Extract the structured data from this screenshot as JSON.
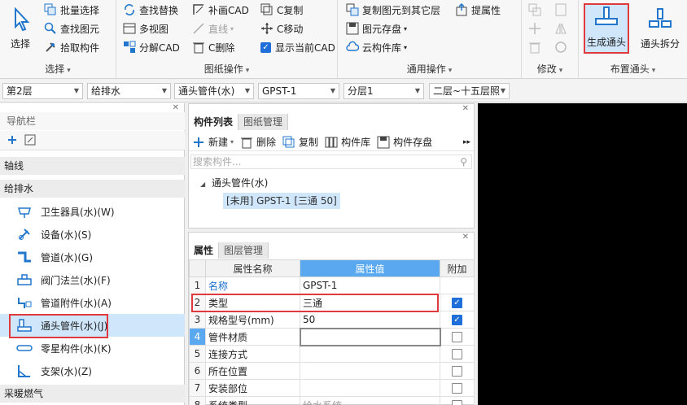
{
  "ribbon": {
    "select_label": "选择",
    "group_select": {
      "label": "选择",
      "items": [
        "批量选择",
        "查找图元",
        "拾取构件"
      ]
    },
    "group_drawing": {
      "label": "图纸操作",
      "col1": [
        "查找替换",
        "多视图",
        "分解CAD"
      ],
      "col2": [
        "补画CAD",
        "直线",
        "C删除"
      ],
      "col3": [
        "C复制",
        "C移动",
        "显示当前CAD"
      ]
    },
    "group_common": {
      "label": "通用操作",
      "col1": [
        "复制图元到其它层",
        "图元存盘",
        "云构件库"
      ],
      "col2": [
        "提属性"
      ]
    },
    "group_modify": {
      "label": "修改"
    },
    "group_tee": {
      "label": "布置通头",
      "generate": "生成通头",
      "split": "通头拆分"
    }
  },
  "combos": [
    {
      "value": "第2层"
    },
    {
      "value": "给排水"
    },
    {
      "value": "通头管件(水)"
    },
    {
      "value": "GPST-1"
    },
    {
      "value": "分层1"
    },
    {
      "value": "二层~十五层照"
    }
  ],
  "nav": {
    "title": "导航栏",
    "section_axis": "轴线",
    "section_plumbing": "给排水",
    "items": [
      {
        "label": "卫生器具(水)(W)"
      },
      {
        "label": "设备(水)(S)"
      },
      {
        "label": "管道(水)(G)"
      },
      {
        "label": "阀门法兰(水)(F)"
      },
      {
        "label": "管道附件(水)(A)"
      },
      {
        "label": "通头管件(水)(J)"
      },
      {
        "label": "零星构件(水)(K)"
      },
      {
        "label": "支架(水)(Z)"
      }
    ],
    "section_heating": "采暖燃气"
  },
  "component_list": {
    "tab_active": "构件列表",
    "tab_other": "图纸管理",
    "tools": [
      "新建",
      "删除",
      "复制",
      "构件库",
      "构件存盘"
    ],
    "search_placeholder": "搜索构件...",
    "tree_root": "通头管件(水)",
    "tree_leaf": "[未用] GPST-1 [三通 50]"
  },
  "properties": {
    "tab_active": "属性",
    "tab_other": "图层管理",
    "headers": {
      "name": "属性名称",
      "value": "属性值",
      "extra": "附加"
    },
    "rows": [
      {
        "num": "1",
        "name": "名称",
        "value": "GPST-1",
        "checked": null
      },
      {
        "num": "2",
        "name": "类型",
        "value": "三通",
        "checked": true
      },
      {
        "num": "3",
        "name": "规格型号(mm)",
        "value": "50",
        "checked": true
      },
      {
        "num": "4",
        "name": "管件材质",
        "value": "",
        "checked": false
      },
      {
        "num": "5",
        "name": "连接方式",
        "value": "",
        "checked": false
      },
      {
        "num": "6",
        "name": "所在位置",
        "value": "",
        "checked": false
      },
      {
        "num": "7",
        "name": "安装部位",
        "value": "",
        "checked": false
      },
      {
        "num": "8",
        "name": "系统类型",
        "value": "给水系统",
        "checked": false
      }
    ]
  },
  "colors": {
    "accent": "#1e6fd9",
    "header_blue": "#5aa9f0",
    "selection": "#cfe6fb",
    "highlight_red": "#e03a3e",
    "canvas": "#000000"
  }
}
